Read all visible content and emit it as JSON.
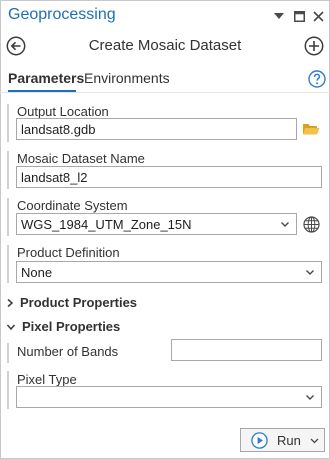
{
  "pane": {
    "title": "Geoprocessing",
    "controls": {
      "menu_glyph": "▼",
      "maximize_glyph": "□",
      "close_glyph": "✕"
    }
  },
  "tool": {
    "title": "Create Mosaic Dataset",
    "back_icon": "back-arrow-icon",
    "add_icon": "add-icon"
  },
  "tabs": [
    {
      "label": "Parameters",
      "active": true
    },
    {
      "label": "Environments",
      "active": false
    }
  ],
  "help_icon": "help-icon",
  "accent_color": "#1d6fb5",
  "params": {
    "output_location": {
      "label": "Output Location",
      "value": "landsat8.gdb"
    },
    "mosaic_name": {
      "label": "Mosaic Dataset Name",
      "value": "landsat8_l2"
    },
    "coordinate_system": {
      "label": "Coordinate System",
      "value": "WGS_1984_UTM_Zone_15N"
    },
    "product_definition": {
      "label": "Product Definition",
      "value": "None"
    }
  },
  "sections": {
    "product_properties": {
      "label": "Product Properties",
      "expanded": false
    },
    "pixel_properties": {
      "label": "Pixel Properties",
      "expanded": true,
      "number_of_bands": {
        "label": "Number of Bands",
        "value": ""
      },
      "pixel_type": {
        "label": "Pixel Type",
        "value": ""
      }
    }
  },
  "run_button": {
    "label": "Run"
  }
}
